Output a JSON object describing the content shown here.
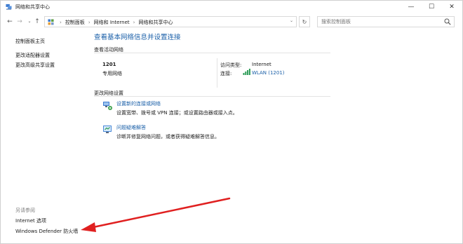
{
  "window": {
    "title": "网络和共享中心",
    "controls": {
      "minimize": "—",
      "maximize": "☐",
      "close": "✕"
    }
  },
  "nav": {
    "back": "←",
    "forward": "→",
    "recent": "⌄",
    "up": "↑",
    "refresh": "↻",
    "breadcrumbs": [
      "控制面板",
      "网络和 Internet",
      "网络和共享中心"
    ],
    "separator": "›",
    "dropdown": "⌄",
    "search_placeholder": "搜索控制面板"
  },
  "sidebar": {
    "links": [
      "控制面板主页",
      "更改适配器设置",
      "更改高级共享设置"
    ],
    "see_also_title": "另请参阅",
    "see_also_links": [
      "Internet 选项",
      "Windows Defender 防火墙"
    ]
  },
  "main": {
    "title": "查看基本网络信息并设置连接",
    "active_networks_label": "查看活动网络",
    "network": {
      "name": "1201",
      "type": "专用网络",
      "access_type_label": "访问类型:",
      "access_type_value": "Internet",
      "connection_label": "连接:",
      "connection_value": "WLAN (1201)"
    },
    "change_settings_label": "更改网络设置",
    "tasks": [
      {
        "link": "设置新的连接或网络",
        "desc": "设置宽带、拨号或 VPN 连接；或设置路由器或接入点。",
        "icon": "network-setup-icon"
      },
      {
        "link": "问题疑难解答",
        "desc": "诊断并修复网络问题，或者获得疑难解答信息。",
        "icon": "troubleshoot-icon"
      }
    ]
  },
  "colors": {
    "link_blue": "#1a5fa8",
    "annotation_red": "#e02020"
  }
}
